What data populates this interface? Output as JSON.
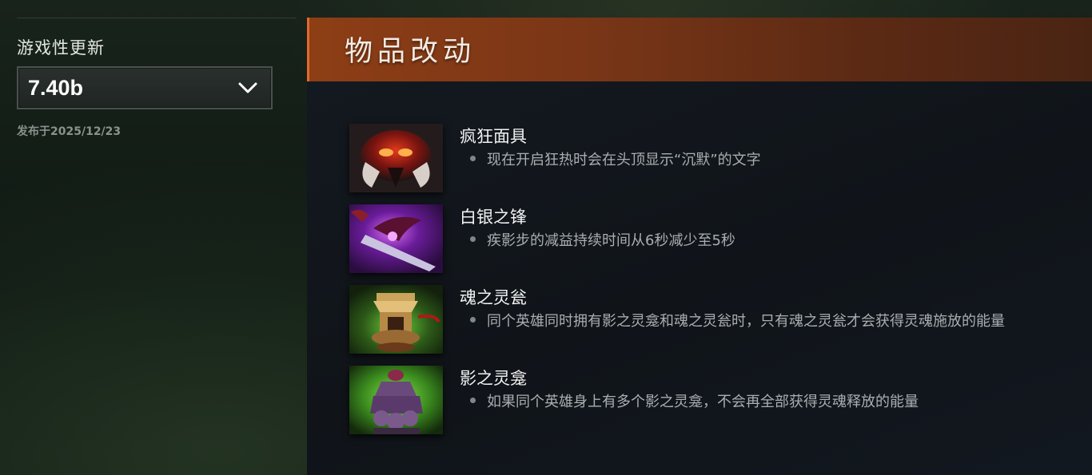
{
  "sidebar": {
    "heading": "游戏性更新",
    "version": "7.40b",
    "released": "发布于2025/12/23"
  },
  "section": {
    "title": "物品改动"
  },
  "items": [
    {
      "name": "疯狂面具",
      "note": "现在开启狂热时会在头顶显示“沉默”的文字",
      "icon": "mask-of-madness-icon"
    },
    {
      "name": "白银之锋",
      "note": "疾影步的减益持续时间从6秒减少至5秒",
      "icon": "silver-edge-icon"
    },
    {
      "name": "魂之灵瓮",
      "note": "同个英雄同时拥有影之灵龛和魂之灵瓮时，只有魂之灵瓮才会获得灵魂施放的能量",
      "icon": "spirit-vessel-icon"
    },
    {
      "name": "影之灵龛",
      "note": "如果同个英雄身上有多个影之灵龛，不会再全部获得灵魂释放的能量",
      "icon": "urn-of-shadows-icon"
    }
  ],
  "colors": {
    "header_orange": "#8d3e15",
    "accent": "#e36a2a"
  }
}
